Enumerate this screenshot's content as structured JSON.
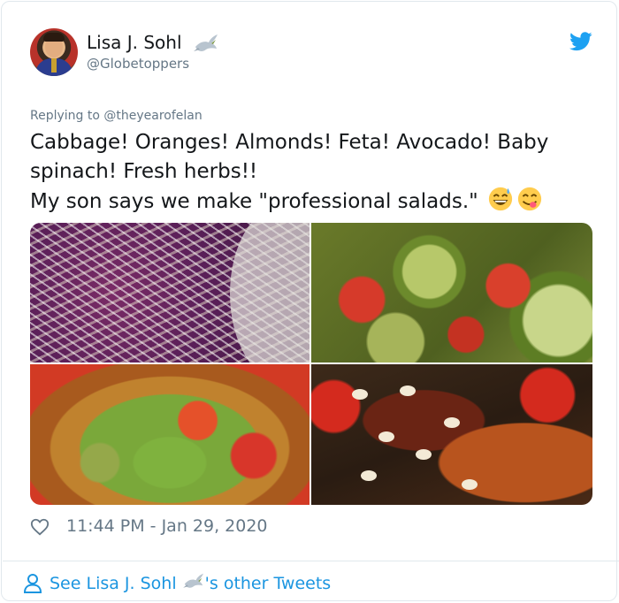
{
  "user": {
    "display_name": "Lisa J. Sohl",
    "handle": "@Globetoppers"
  },
  "reply": {
    "prefix": "Replying to ",
    "to": "@theyearofelan"
  },
  "tweet": {
    "line1": "Cabbage! Oranges! Almonds! Feta! Avocado! Baby",
    "line2": "spinach! Fresh herbs!!",
    "line3": "My son says we make \"professional salads.\""
  },
  "timestamp": "11:44 PM - Jan 29, 2020",
  "footer": {
    "see_prefix": "See Lisa J. Sohl ",
    "see_suffix": "'s other Tweets"
  },
  "colors": {
    "link_blue": "#1b95e0",
    "twitter_blue": "#1da1f2",
    "muted_gray": "#657786",
    "text": "#14171a"
  },
  "icons": [
    "dove-icon",
    "twitter-bird-icon",
    "heart-icon",
    "person-icon",
    "grinning-sweat-emoji",
    "yum-emoji"
  ]
}
